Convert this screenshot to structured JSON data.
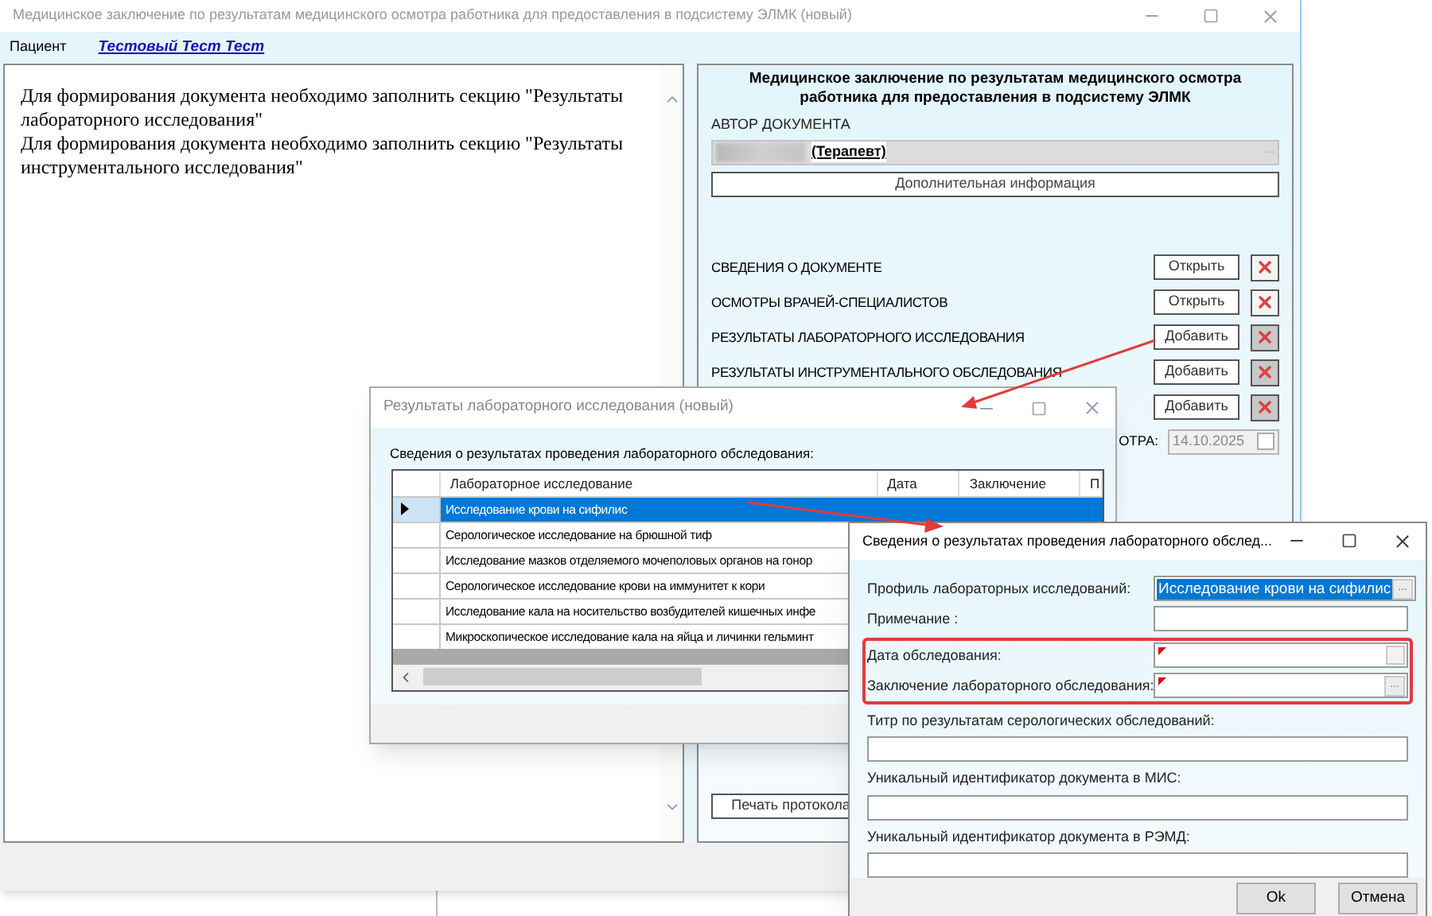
{
  "main_window": {
    "title": "Медицинское заключение по результатам медицинского осмотра работника для предоставления в подсистему ЭЛМК (новый)",
    "patient_label": "Пациент",
    "patient_name": "Тестовый Тест Тест",
    "messages": [
      "Для формирования документа необходимо заполнить секцию \"Результаты лабораторного исследования\"",
      "Для формирования документа необходимо заполнить секцию \"Результаты инструментального исследования\""
    ],
    "document_title": "Медицинское заключение по результатам медицинского осмотра работника для предоставления в подсистему ЭЛМК",
    "author_label": "АВТОР ДОКУМЕНТА",
    "author_value": "(Терапевт)",
    "author_button": "...",
    "extra_info_button": "Дополнительная информация",
    "sections": [
      {
        "label": "СВЕДЕНИЯ О ДОКУМЕНТЕ",
        "action": "Открыть",
        "filled": true
      },
      {
        "label": "ОСМОТРЫ ВРАЧЕЙ-СПЕЦИАЛИСТОВ",
        "action": "Открыть",
        "filled": true
      },
      {
        "label": "РЕЗУЛЬТАТЫ ЛАБОРАТОРНОГО ИССЛЕДОВАНИЯ",
        "action": "Добавить",
        "filled": false
      },
      {
        "label": "РЕЗУЛЬТАТЫ ИНСТРУМЕНТАЛЬНОГО ОБСЛЕДОВАНИЯ",
        "action": "Добавить",
        "filled": false
      },
      {
        "action": "Добавить",
        "filled": false
      }
    ],
    "date_label": "ОТРА:",
    "date_value": "14.10.2025",
    "print_button": "Печать протокола"
  },
  "lab_dialog": {
    "title": "Результаты лабораторного исследования (новый)",
    "caption": "Сведения о результатах проведения лабораторного обследования:",
    "columns": [
      "Лабораторное исследование",
      "Дата",
      "Заключение",
      "П"
    ],
    "rows": [
      {
        "study": "Исследование крови на сифилис",
        "selected": true
      },
      {
        "study": "Серологическое исследование на брюшной тиф",
        "selected": false
      },
      {
        "study": "Исследование мазков отделяемого мочеполовых органов на гонор",
        "selected": false
      },
      {
        "study": "Серологическое исследование крови на иммунитет к кори",
        "selected": false
      },
      {
        "study": "Исследование кала на носительство возбудителей кишечных инфе",
        "selected": false
      },
      {
        "study": "Микроскопическое исследование кала на яйца и личинки гельминт",
        "selected": false
      }
    ]
  },
  "details_dialog": {
    "title": "Сведения о результатах проведения лабораторного обслед...",
    "field_groups": [
      {
        "highlighted": false,
        "fields": [
          {
            "label": "Профиль лабораторных исследований:",
            "kind": "lookup",
            "value": "Исследование крови на сифилис",
            "button": "...",
            "required": false
          },
          {
            "label": "Примечание :",
            "kind": "text",
            "required": false
          }
        ]
      },
      {
        "highlighted": true,
        "fields": [
          {
            "label": "Дата обследования:",
            "kind": "date",
            "required": true
          },
          {
            "label": "Заключение лабораторного обследования:",
            "kind": "lookup",
            "button": "...",
            "required": true
          }
        ]
      }
    ],
    "stacked_fields": [
      {
        "label": "Титр по результатам серологических обследований:",
        "required": false
      },
      {
        "label": "Уникальный идентификатор документа в МИС:",
        "required": false
      },
      {
        "label": "Уникальный идентификатор документа в РЭМД:",
        "required": false
      }
    ],
    "buttons": [
      "Ok",
      "Отмена"
    ]
  }
}
